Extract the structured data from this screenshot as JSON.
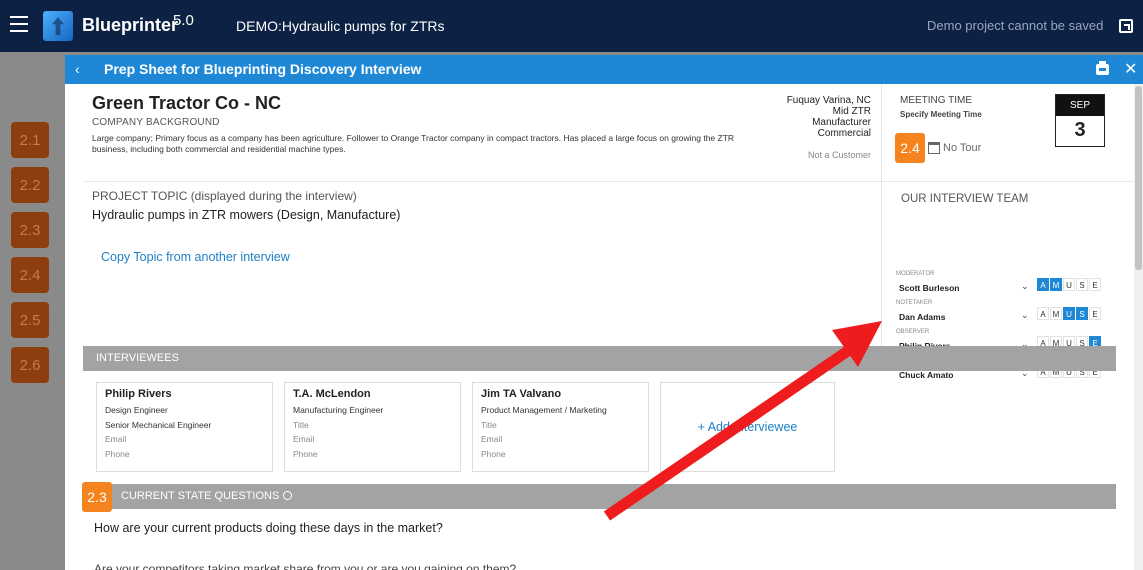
{
  "app": {
    "name": "Blueprinter",
    "version": "5.0",
    "project": "DEMO:Hydraulic pumps for ZTRs",
    "demo_note": "Demo project cannot be saved"
  },
  "steps": [
    "2.1",
    "2.2",
    "2.3",
    "2.4",
    "2.5",
    "2.6"
  ],
  "modal": {
    "title": "Prep Sheet for Blueprinting Discovery Interview",
    "company": {
      "name": "Green Tractor Co - NC",
      "background_label": "COMPANY BACKGROUND",
      "background_text": "Large company; Primary focus as a company has been agriculture. Follower to Orange Tractor company in compact tractors. Has placed a large focus on growing the ZTR business, including both commercial and residential machine types.",
      "location": "Fuquay Varina, NC",
      "size": "Mid ZTR",
      "type": "Manufacturer",
      "segment": "Commercial",
      "customer_status": "Not a Customer"
    },
    "meeting": {
      "label": "MEETING TIME",
      "sub": "Specify Meeting Time",
      "badge": "2.4",
      "tour": "No Tour",
      "month": "SEP",
      "day": "3"
    },
    "team": {
      "title": "OUR INTERVIEW TEAM",
      "letters": [
        "A",
        "M",
        "U",
        "S",
        "E"
      ],
      "members": [
        {
          "role": "MODERATOR",
          "name": "Scott Burleson",
          "active": [
            0,
            1
          ]
        },
        {
          "role": "NOTETAKER",
          "name": "Dan Adams",
          "active": [
            2,
            3
          ]
        },
        {
          "role": "OBSERVER",
          "name": "Philip Rivers",
          "active": [
            4
          ]
        },
        {
          "role": "OBSERVER",
          "name": "Chuck Amato",
          "active": []
        }
      ]
    },
    "topic": {
      "label": "PROJECT TOPIC (displayed during the interview)",
      "text": "Hydraulic pumps in ZTR mowers (Design, Manufacture)",
      "copy_link": "Copy Topic from another interview"
    },
    "interviewees": {
      "title": "INTERVIEWEES",
      "people": [
        {
          "name": "Philip Rivers",
          "title": "Design Engineer",
          "line2": "Senior Mechanical Engineer",
          "email": "Email",
          "phone": "Phone"
        },
        {
          "name": "T.A. McLendon",
          "title": "Manufacturing Engineer",
          "line2": "Title",
          "email": "Email",
          "phone": "Phone"
        },
        {
          "name": "Jim TA Valvano",
          "title": "Product Management / Marketing",
          "line2": "Title",
          "email": "Email",
          "phone": "Phone"
        }
      ],
      "add_label": "+ Add Interviewee"
    },
    "current_state": {
      "badge": "2.3",
      "title": "CURRENT STATE QUESTIONS",
      "question": "How are your current products doing these days in the market?",
      "cutoff": "Are your competitors taking market share from you or are you gaining on them?"
    }
  },
  "colors": {
    "appbar": "#0d2145",
    "modal_header": "#1e88d6",
    "badge": "#f5841f",
    "step_tile": "#8c3e0f",
    "section_bar": "#a3a3a3",
    "arrow": "#ee1c1c"
  }
}
